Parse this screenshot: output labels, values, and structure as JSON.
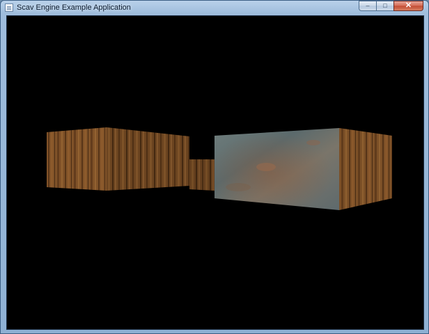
{
  "window": {
    "title": "Scav Engine Example Application",
    "caption_buttons": {
      "minimize_glyph": "–",
      "maximize_glyph": "□",
      "close_glyph": "✕"
    }
  },
  "scene": {
    "background_color": "#000000",
    "wood_color": "#8a5a2b",
    "metal_color": "#5f6f72",
    "objects": [
      "wood-box-left",
      "wood-connector",
      "metal-box-right"
    ]
  },
  "icons": [
    "app-icon",
    "minimize-icon",
    "maximize-icon",
    "close-icon"
  ]
}
